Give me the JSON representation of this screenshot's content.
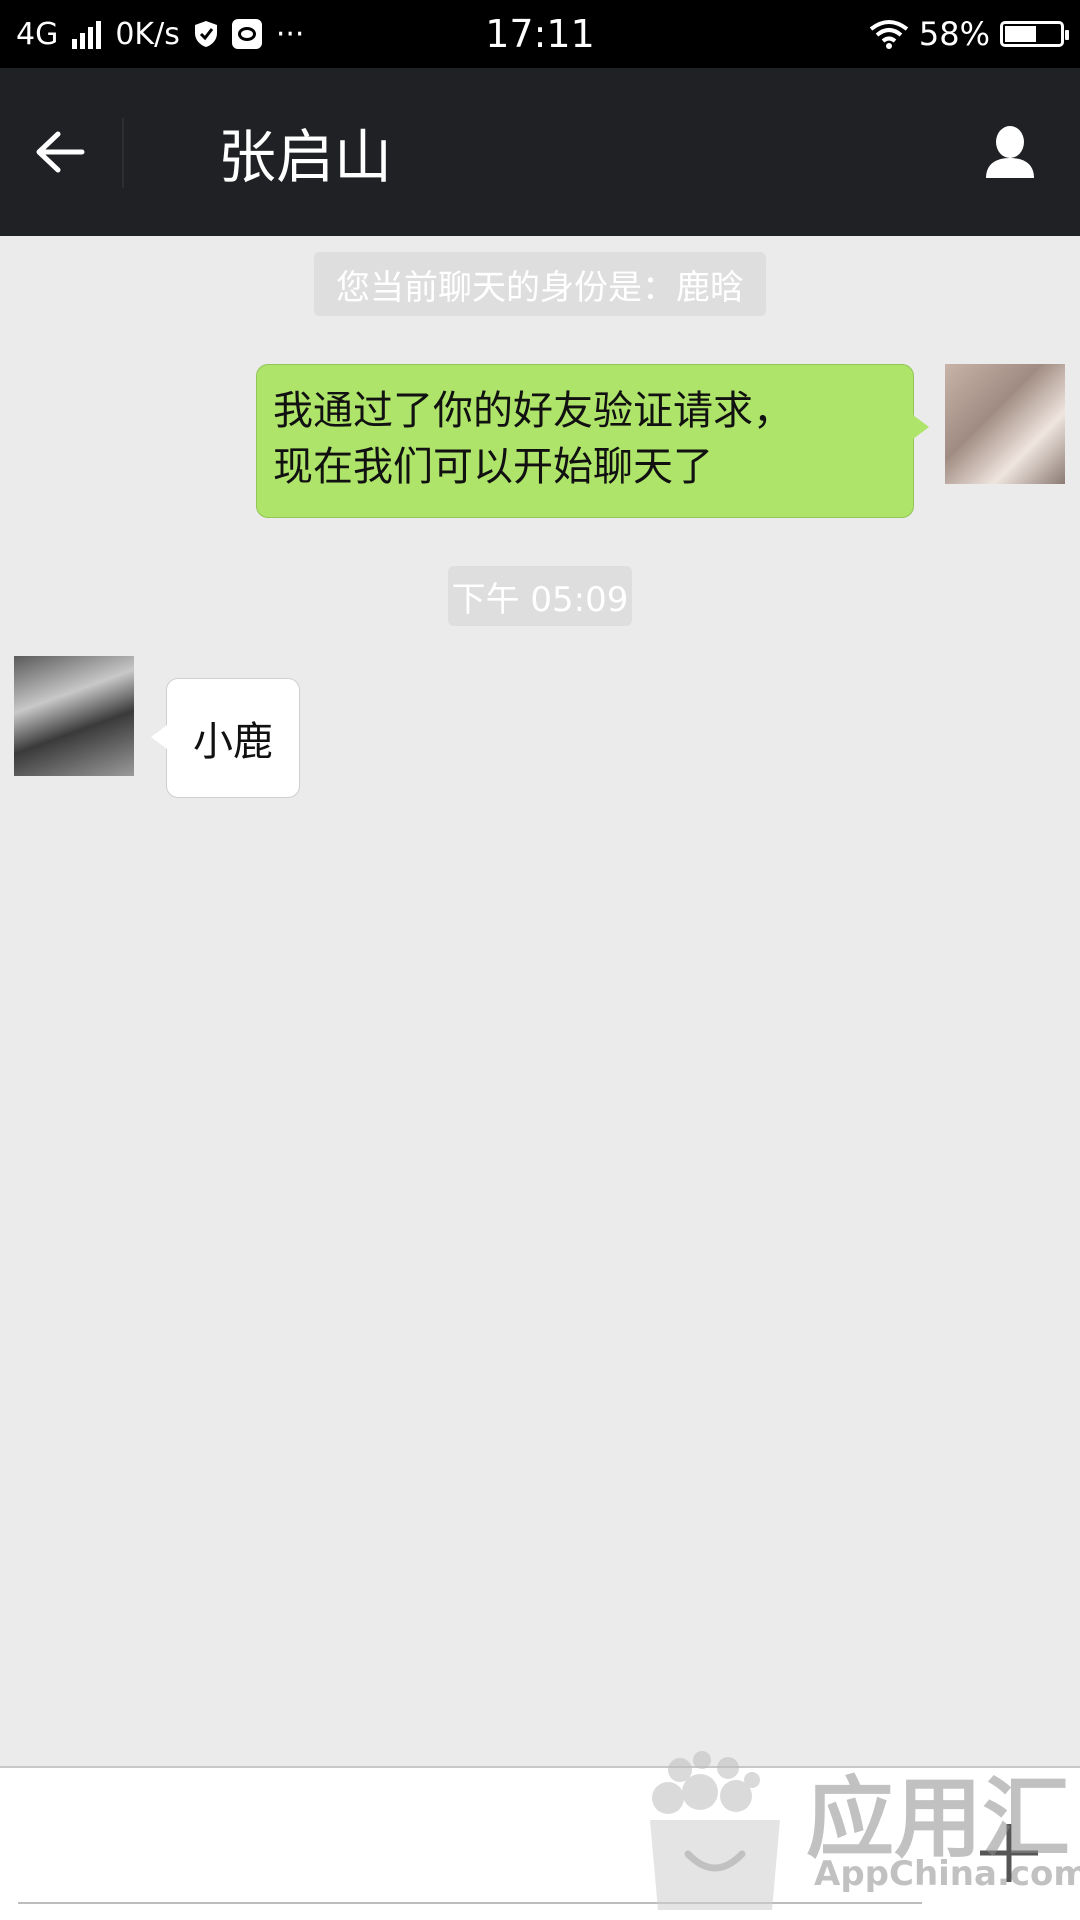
{
  "status_bar": {
    "network": "4G",
    "speed": "0K/s",
    "more": "···",
    "time": "17:11",
    "battery_percent": "58%",
    "battery_level": 0.58
  },
  "header": {
    "contact_name": "张启山"
  },
  "chat": {
    "system_notice": "您当前聊天的身份是：鹿晗",
    "outgoing_message": {
      "line1": "我通过了你的好友验证请求，",
      "line2": "现在我们可以开始聊天了"
    },
    "timestamp": "下午 05:09",
    "incoming_message": "小鹿"
  },
  "input_bar": {
    "value": ""
  },
  "watermark": {
    "title": "应用汇",
    "subtitle": "AppChina.com"
  },
  "colors": {
    "header_bg": "#1f2124",
    "chat_bg": "#ebebeb",
    "outgoing_bubble": "#aee469",
    "incoming_bubble": "#ffffff"
  }
}
